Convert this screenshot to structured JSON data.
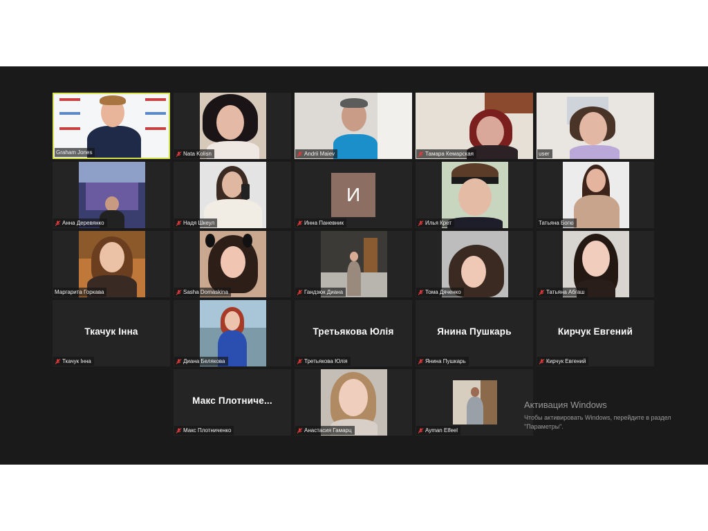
{
  "participants": [
    {
      "name": "Graham Jones",
      "muted": false,
      "active": true
    },
    {
      "name": "Nata Kolisn",
      "muted": true
    },
    {
      "name": "Andrii Maiev",
      "muted": true
    },
    {
      "name": "Тамара Кемарская",
      "muted": true
    },
    {
      "name": "user",
      "muted": false
    },
    {
      "name": "Анна Деревянко",
      "muted": true
    },
    {
      "name": "Надя Шкеул",
      "muted": true
    },
    {
      "name": "Инна Паневник",
      "muted": true,
      "initial": "И",
      "initial_color": "#8d6e63"
    },
    {
      "name": "Илья Крет",
      "muted": true
    },
    {
      "name": "Татьяна Богю",
      "muted": false
    },
    {
      "name": "Маргарита Горкава",
      "muted": false
    },
    {
      "name": "Sasha Domaskina",
      "muted": true
    },
    {
      "name": "Гандзюк Диана",
      "muted": true
    },
    {
      "name": "Тома Дяченко",
      "muted": true
    },
    {
      "name": "Татьяна Абгаш",
      "muted": true
    },
    {
      "name": "Ткачук Інна",
      "muted": true,
      "display_name": "Ткачук Інна"
    },
    {
      "name": "Диана Белякова",
      "muted": true
    },
    {
      "name": "Третьякова Юлія",
      "muted": true,
      "display_name": "Третьякова Юлія"
    },
    {
      "name": "Янина Пушкарь",
      "muted": true,
      "display_name": "Янина Пушкарь"
    },
    {
      "name": "Кирчук Евгений",
      "muted": true,
      "display_name": "Кирчук Евгений"
    },
    {
      "name": "Макс Плотниченко",
      "muted": true,
      "display_name": "Макс  Плотниче..."
    },
    {
      "name": "Анастасия Гамарц",
      "muted": true
    },
    {
      "name": "Ayman Elfeel",
      "muted": true
    }
  ],
  "activation": {
    "title": "Активация Windows",
    "line1": "Чтобы активировать Windows, перейдите в раздел",
    "line2": "\"Параметры\"."
  },
  "colors": {
    "active_border": "#d8e34b",
    "mic_muted": "#e03b3b",
    "stage_bg": "#1a1a1a",
    "tile_bg": "#242424"
  }
}
